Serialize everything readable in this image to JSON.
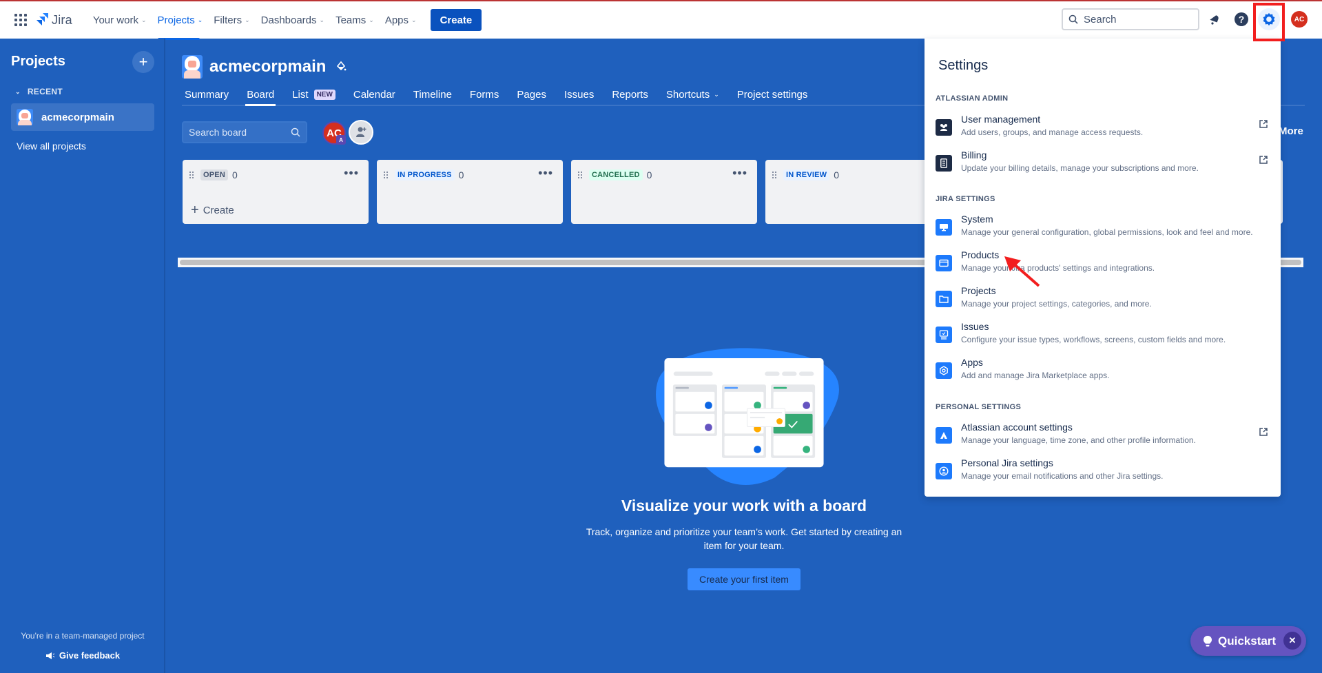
{
  "topnav": {
    "logo": "Jira",
    "items": [
      {
        "label": "Your work",
        "active": false
      },
      {
        "label": "Projects",
        "active": true
      },
      {
        "label": "Filters",
        "active": false
      },
      {
        "label": "Dashboards",
        "active": false
      },
      {
        "label": "Teams",
        "active": false
      },
      {
        "label": "Apps",
        "active": false
      }
    ],
    "create_label": "Create",
    "search_placeholder": "Search",
    "avatar_initials": "AC"
  },
  "sidebar": {
    "title": "Projects",
    "recent_label": "RECENT",
    "recent_projects": [
      {
        "name": "acmecorpmain"
      }
    ],
    "view_all": "View all projects",
    "team_note": "You're in a team-managed project",
    "feedback": "Give feedback"
  },
  "project": {
    "name": "acmecorpmain",
    "tabs": [
      {
        "label": "Summary"
      },
      {
        "label": "Board",
        "active": true
      },
      {
        "label": "List",
        "badge": "NEW"
      },
      {
        "label": "Calendar"
      },
      {
        "label": "Timeline"
      },
      {
        "label": "Forms"
      },
      {
        "label": "Pages"
      },
      {
        "label": "Issues"
      },
      {
        "label": "Reports"
      },
      {
        "label": "Shortcuts",
        "dropdown": true
      },
      {
        "label": "Project settings"
      }
    ]
  },
  "board": {
    "search_placeholder": "Search board",
    "member_initials": "AC",
    "member_badge": "A",
    "more_label": "More",
    "columns": [
      {
        "name": "OPEN",
        "count": "0",
        "style": "grey",
        "create_label": "Create"
      },
      {
        "name": "IN PROGRESS",
        "count": "0",
        "style": "blue"
      },
      {
        "name": "CANCELLED",
        "count": "0",
        "style": "green"
      },
      {
        "name": "IN REVIEW",
        "count": "0",
        "style": "blue"
      }
    ]
  },
  "empty_state": {
    "title": "Visualize your work with a board",
    "description": "Track, organize and prioritize your team’s work. Get started by creating an item for your team.",
    "button": "Create your first item"
  },
  "quickstart": {
    "label": "Quickstart"
  },
  "settings_menu": {
    "title": "Settings",
    "sections": [
      {
        "heading": "ATLASSIAN ADMIN",
        "items": [
          {
            "label": "User management",
            "description": "Add users, groups, and manage access requests.",
            "icon": "people-icon",
            "external": true
          },
          {
            "label": "Billing",
            "description": "Update your billing details, manage your subscriptions and more.",
            "icon": "billing-icon",
            "external": true
          }
        ]
      },
      {
        "heading": "JIRA SETTINGS",
        "items": [
          {
            "label": "System",
            "description": "Manage your general configuration, global permissions, look and feel and more.",
            "icon": "monitor-icon"
          },
          {
            "label": "Products",
            "description": "Manage your Jira products' settings and integrations.",
            "icon": "window-icon"
          },
          {
            "label": "Projects",
            "description": "Manage your project settings, categories, and more.",
            "icon": "folder-icon"
          },
          {
            "label": "Issues",
            "description": "Configure your issue types, workflows, screens, custom fields and more.",
            "icon": "issue-icon"
          },
          {
            "label": "Apps",
            "description": "Add and manage Jira Marketplace apps.",
            "icon": "app-icon"
          }
        ]
      },
      {
        "heading": "PERSONAL SETTINGS",
        "items": [
          {
            "label": "Atlassian account settings",
            "description": "Manage your language, time zone, and other profile information.",
            "icon": "atlassian-icon",
            "external": true
          },
          {
            "label": "Personal Jira settings",
            "description": "Manage your email notifications and other Jira settings.",
            "icon": "person-icon"
          }
        ]
      }
    ]
  },
  "colors": {
    "brand_blue": "#0c66e4",
    "page_bg": "#1f60bd",
    "quickstart": "#6554c0",
    "highlight_red": "#f21e1e"
  }
}
